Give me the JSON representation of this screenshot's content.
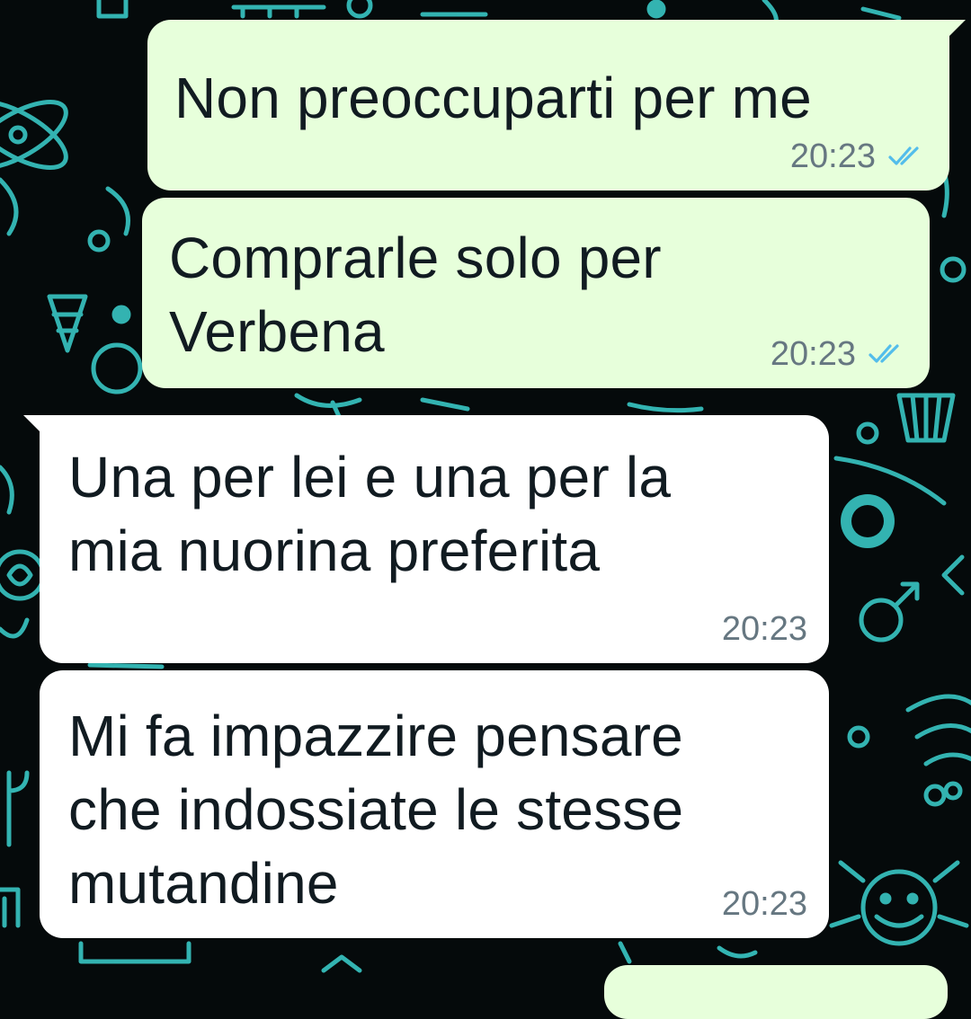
{
  "theme": {
    "background": "#050a0b",
    "pattern_color": "#39c6c4",
    "outgoing_bubble": "#e7ffdb",
    "incoming_bubble": "#ffffff",
    "read_ticks": "#53bdeb",
    "time_color": "#667781"
  },
  "messages": [
    {
      "direction": "out",
      "text": "Non preoccuparti per me",
      "time": "20:23",
      "status": "read",
      "status_icon": "double-check-icon"
    },
    {
      "direction": "out",
      "text": "Comprarle solo per\nVerbena",
      "time": "20:23",
      "status": "read",
      "status_icon": "double-check-icon"
    },
    {
      "direction": "in",
      "text": "Una per lei e una per la\nmia nuorina preferita",
      "time": "20:23"
    },
    {
      "direction": "in",
      "text": "Mi fa impazzire pensare\nche indossiate le stesse\nmutandine",
      "time": "20:23"
    }
  ]
}
